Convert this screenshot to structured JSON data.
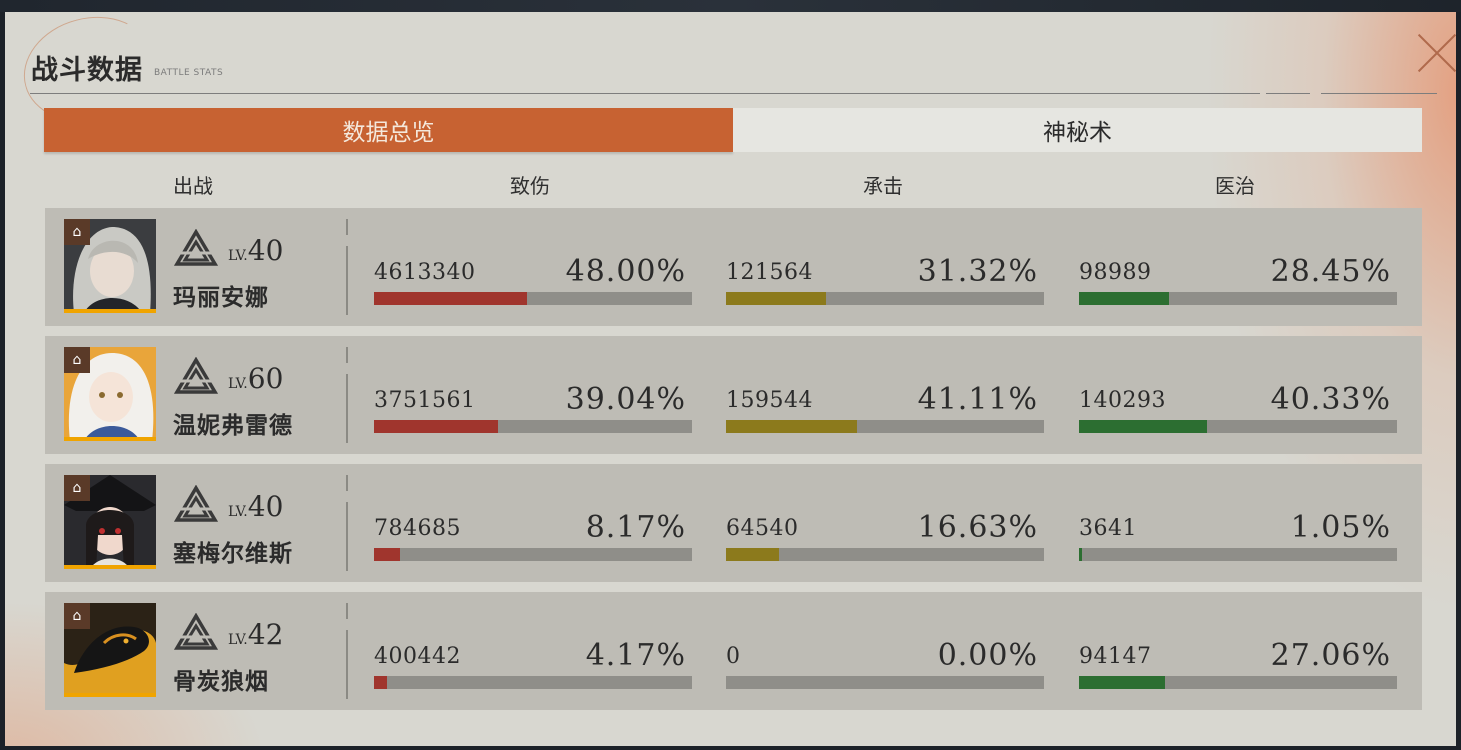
{
  "header": {
    "title": "战斗数据",
    "subtitle": "BATTLE STATS"
  },
  "tabs": [
    {
      "label": "数据总览",
      "active": true
    },
    {
      "label": "神秘术",
      "active": false
    }
  ],
  "columns": {
    "deploy": "出战",
    "damage": "致伤",
    "taken": "承击",
    "heal": "医治"
  },
  "colors": {
    "damage": "#a0352d",
    "taken": "#8c7a1c",
    "heal": "#2c6e31",
    "accent": "#c76232"
  },
  "level_prefix": "LV.",
  "role_icon": "house-role-icon",
  "characters": [
    {
      "name": "玛丽安娜",
      "level": "40",
      "damage": {
        "value": "4613340",
        "pct": "48.00%",
        "ratio": 0.48
      },
      "taken": {
        "value": "121564",
        "pct": "31.32%",
        "ratio": 0.3132
      },
      "heal": {
        "value": "98989",
        "pct": "28.45%",
        "ratio": 0.2845
      }
    },
    {
      "name": "温妮弗雷德",
      "level": "60",
      "damage": {
        "value": "3751561",
        "pct": "39.04%",
        "ratio": 0.3904
      },
      "taken": {
        "value": "159544",
        "pct": "41.11%",
        "ratio": 0.4111
      },
      "heal": {
        "value": "140293",
        "pct": "40.33%",
        "ratio": 0.4033
      }
    },
    {
      "name": "塞梅尔维斯",
      "level": "40",
      "damage": {
        "value": "784685",
        "pct": "8.17%",
        "ratio": 0.0817
      },
      "taken": {
        "value": "64540",
        "pct": "16.63%",
        "ratio": 0.1663
      },
      "heal": {
        "value": "3641",
        "pct": "1.05%",
        "ratio": 0.0105
      }
    },
    {
      "name": "骨炭狼烟",
      "level": "42",
      "damage": {
        "value": "400442",
        "pct": "4.17%",
        "ratio": 0.0417
      },
      "taken": {
        "value": "0",
        "pct": "0.00%",
        "ratio": 0
      },
      "heal": {
        "value": "94147",
        "pct": "27.06%",
        "ratio": 0.2706
      }
    }
  ]
}
